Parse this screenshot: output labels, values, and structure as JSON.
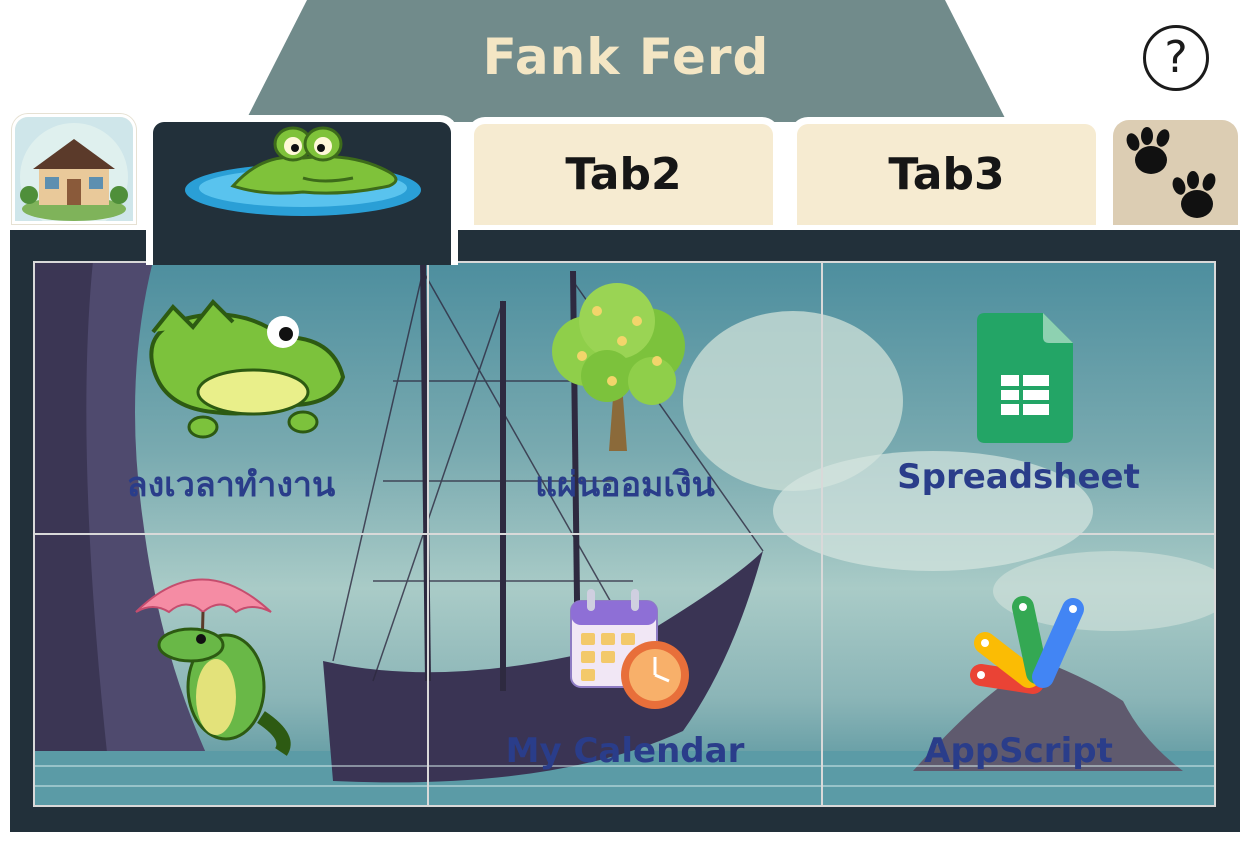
{
  "header": {
    "title": "Fank Ferd",
    "help_label": "?"
  },
  "tabs": {
    "home_icon": "house-icon",
    "active_icon": "crocodile-in-water-icon",
    "tab2_label": "Tab2",
    "tab3_label": "Tab3",
    "paw_icon": "paw-prints-icon"
  },
  "grid": {
    "items": [
      {
        "label": "ลงเวลาทำงาน",
        "icon": "crocodile-icon"
      },
      {
        "label": "แผ่นออมเงิน",
        "icon": "money-tree-icon"
      },
      {
        "label": "Spreadsheet",
        "icon": "google-sheets-icon"
      },
      {
        "label": "",
        "icon": "crocodile-umbrella-icon"
      },
      {
        "label": "My Calendar",
        "icon": "calendar-clock-icon"
      },
      {
        "label": "AppScript",
        "icon": "apps-script-icon"
      }
    ]
  },
  "colors": {
    "title_bar": "#718b8b",
    "title_text": "#f4e6c4",
    "panel": "#22303a",
    "tab_bg": "#f6ebd1",
    "label_text": "#2a3d8a"
  }
}
